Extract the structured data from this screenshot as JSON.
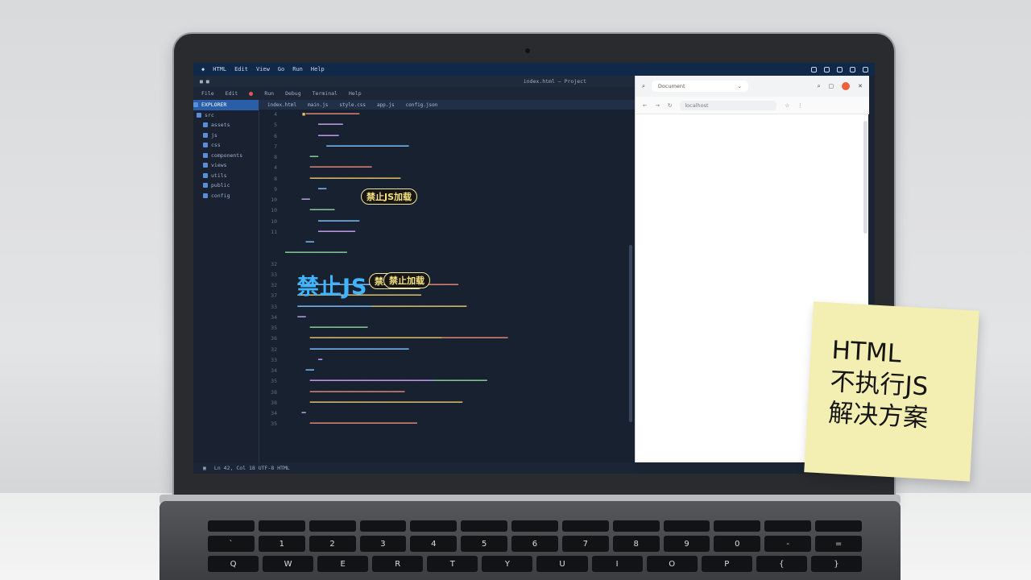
{
  "menubar": {
    "items": [
      "HTML",
      "Edit",
      "View",
      "Go",
      "Run",
      "Help"
    ],
    "window_title": "index.html — Project"
  },
  "editor": {
    "toolbar_items": [
      "File",
      "Edit",
      "Run",
      "Debug",
      "Terminal",
      "Help"
    ],
    "tabs": [
      "index.html",
      "main.js",
      "style.css",
      "app.js",
      "config.json"
    ],
    "sidebar": [
      "EXPLORER",
      "src",
      "assets",
      "js",
      "css",
      "components",
      "views",
      "utils",
      "public",
      "config"
    ],
    "line_numbers": [
      "4",
      "5",
      "6",
      "7",
      "8",
      "4",
      "8",
      "9",
      "10",
      "10",
      "10",
      "11",
      "",
      "",
      "32",
      "33",
      "32",
      "37",
      "33",
      "34",
      "35",
      "36",
      "32",
      "33",
      "34",
      "35",
      "38",
      "38",
      "34",
      "35"
    ],
    "badges": [
      "禁止JS加载",
      "禁止JS加载",
      "禁止加载"
    ],
    "big_label": "禁止JS",
    "status": "Ln 42, Col 18  UTF-8  HTML"
  },
  "browser": {
    "tab_title": "Document",
    "address": "localhost"
  },
  "sticky_note": {
    "lines": [
      "HTML",
      "不执行JS",
      "解决方案"
    ]
  },
  "keyboard": {
    "row1": [
      "~",
      "!",
      "@",
      "#",
      "$",
      "%",
      "^",
      "&",
      "*",
      "(",
      ")",
      "_",
      "+"
    ],
    "row2": [
      "`",
      "1",
      "2",
      "3",
      "4",
      "5",
      "6",
      "7",
      "8",
      "9",
      "0",
      "-",
      "="
    ],
    "row3": [
      "Q",
      "W",
      "E",
      "R",
      "T",
      "Y",
      "U",
      "I",
      "O",
      "P",
      "{",
      "}"
    ]
  }
}
